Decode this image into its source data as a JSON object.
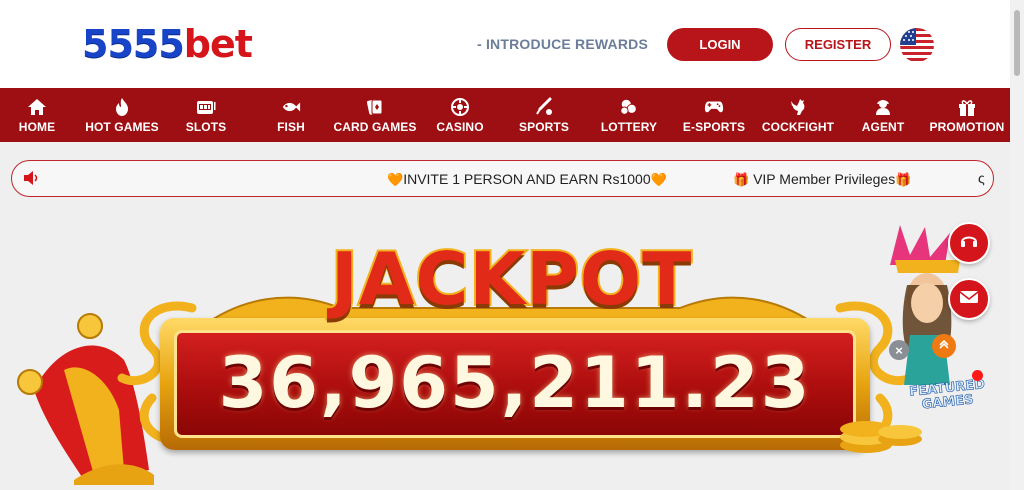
{
  "header": {
    "logo": {
      "number": "5555",
      "text": "bet"
    },
    "introduce_link": "- INTRODUCE REWARDS",
    "login_label": "LOGIN",
    "register_label": "REGISTER",
    "language_flag": "us-flag-icon"
  },
  "nav": {
    "items": [
      {
        "label": "HOME",
        "icon": "home-icon"
      },
      {
        "label": "HOT GAMES",
        "icon": "flame-icon"
      },
      {
        "label": "SLOTS",
        "icon": "slot-machine-icon"
      },
      {
        "label": "FISH",
        "icon": "fish-icon"
      },
      {
        "label": "CARD GAMES",
        "icon": "cards-icon"
      },
      {
        "label": "CASINO",
        "icon": "casino-icon"
      },
      {
        "label": "SPORTS",
        "icon": "sports-icon"
      },
      {
        "label": "LOTTERY",
        "icon": "lottery-icon"
      },
      {
        "label": "E-SPORTS",
        "icon": "gamepad-icon"
      },
      {
        "label": "COCKFIGHT",
        "icon": "rooster-icon"
      },
      {
        "label": "AGENT",
        "icon": "agent-icon"
      },
      {
        "label": "PROMOTION",
        "icon": "gift-icon"
      }
    ]
  },
  "marquee": {
    "message1": "INVITE 1 PERSON AND EARN Rs1000",
    "message2": "VIP Member Privileges",
    "message3": "ς"
  },
  "banner": {
    "title": "JACKPOT",
    "jackpot_value": "36,965,211.23",
    "featured_label": "FEATURED GAMES"
  },
  "colors": {
    "brand_red": "#9e0f13",
    "button_red": "#b8151a",
    "logo_blue": "#1845c8",
    "gold": "#f2b21d"
  }
}
